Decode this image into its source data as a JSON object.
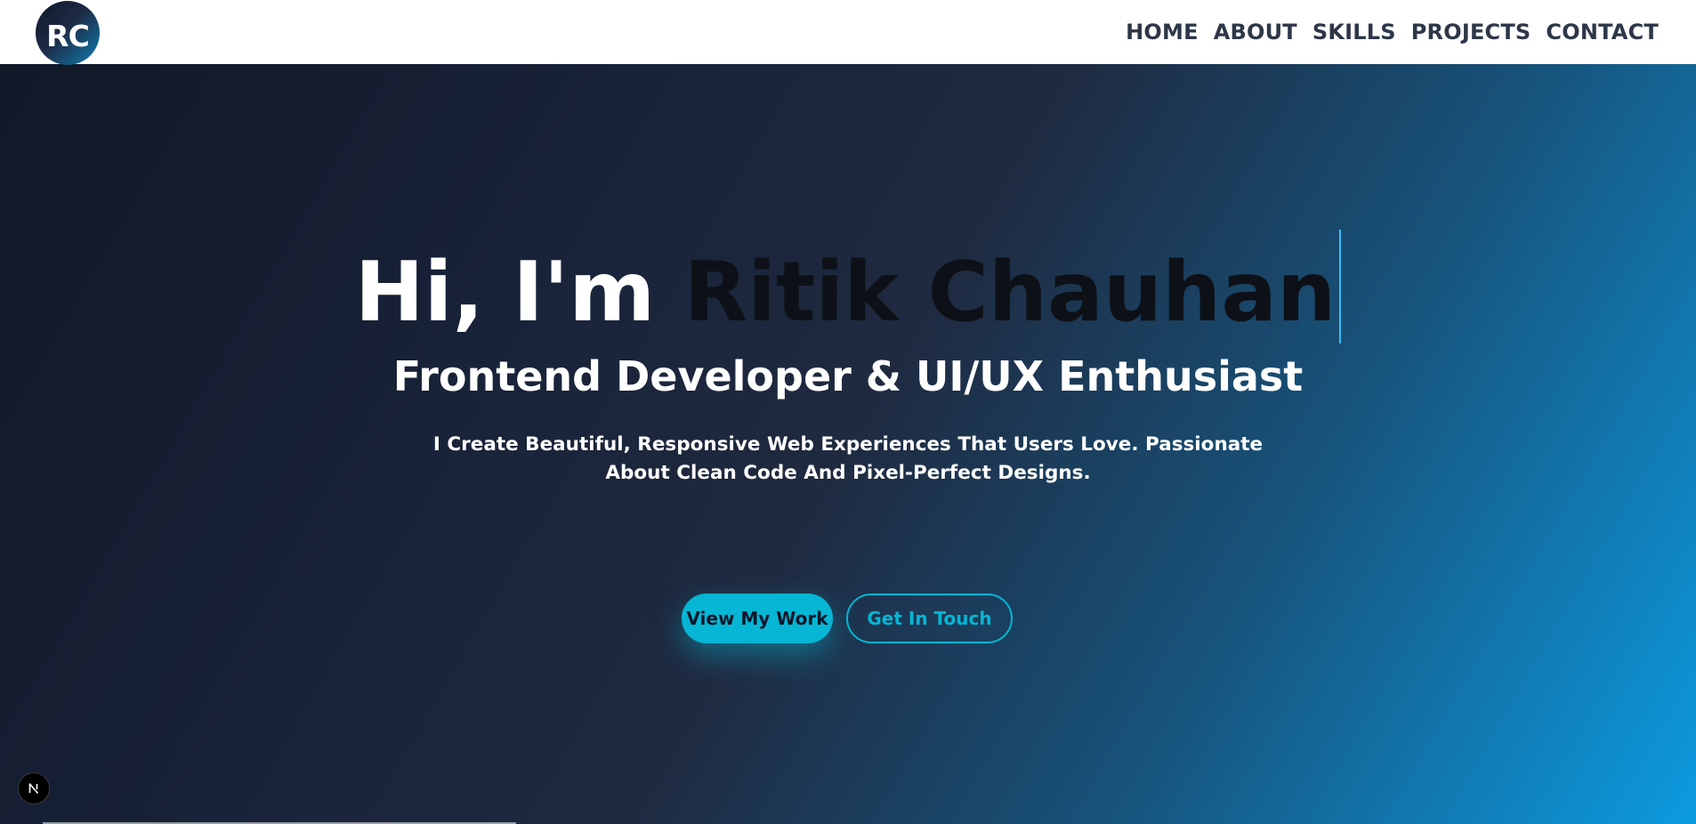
{
  "navbar": {
    "logo_text": "RC",
    "links": [
      "HOME",
      "ABOUT",
      "SKILLS",
      "PROJECTS",
      "CONTACT"
    ]
  },
  "hero": {
    "greeting_prefix": "Hi, I'm ",
    "name": "Ritik Chauhan",
    "subtitle": "Frontend Developer & UI/UX Enthusiast",
    "tagline": "I Create Beautiful, Responsive Web Experiences That Users Love. Passionate About Clean Code And Pixel-Perfect Designs.",
    "primary_button": "View My Work",
    "secondary_button": "Get In Touch"
  },
  "dev_badge": {
    "letter": "N",
    "icon": "nextjs-logo-icon"
  },
  "colors": {
    "accent": "#06b6d4",
    "nav_text": "#2d3748",
    "hero_dark": "#111827",
    "hero_light": "#0c9be0"
  }
}
